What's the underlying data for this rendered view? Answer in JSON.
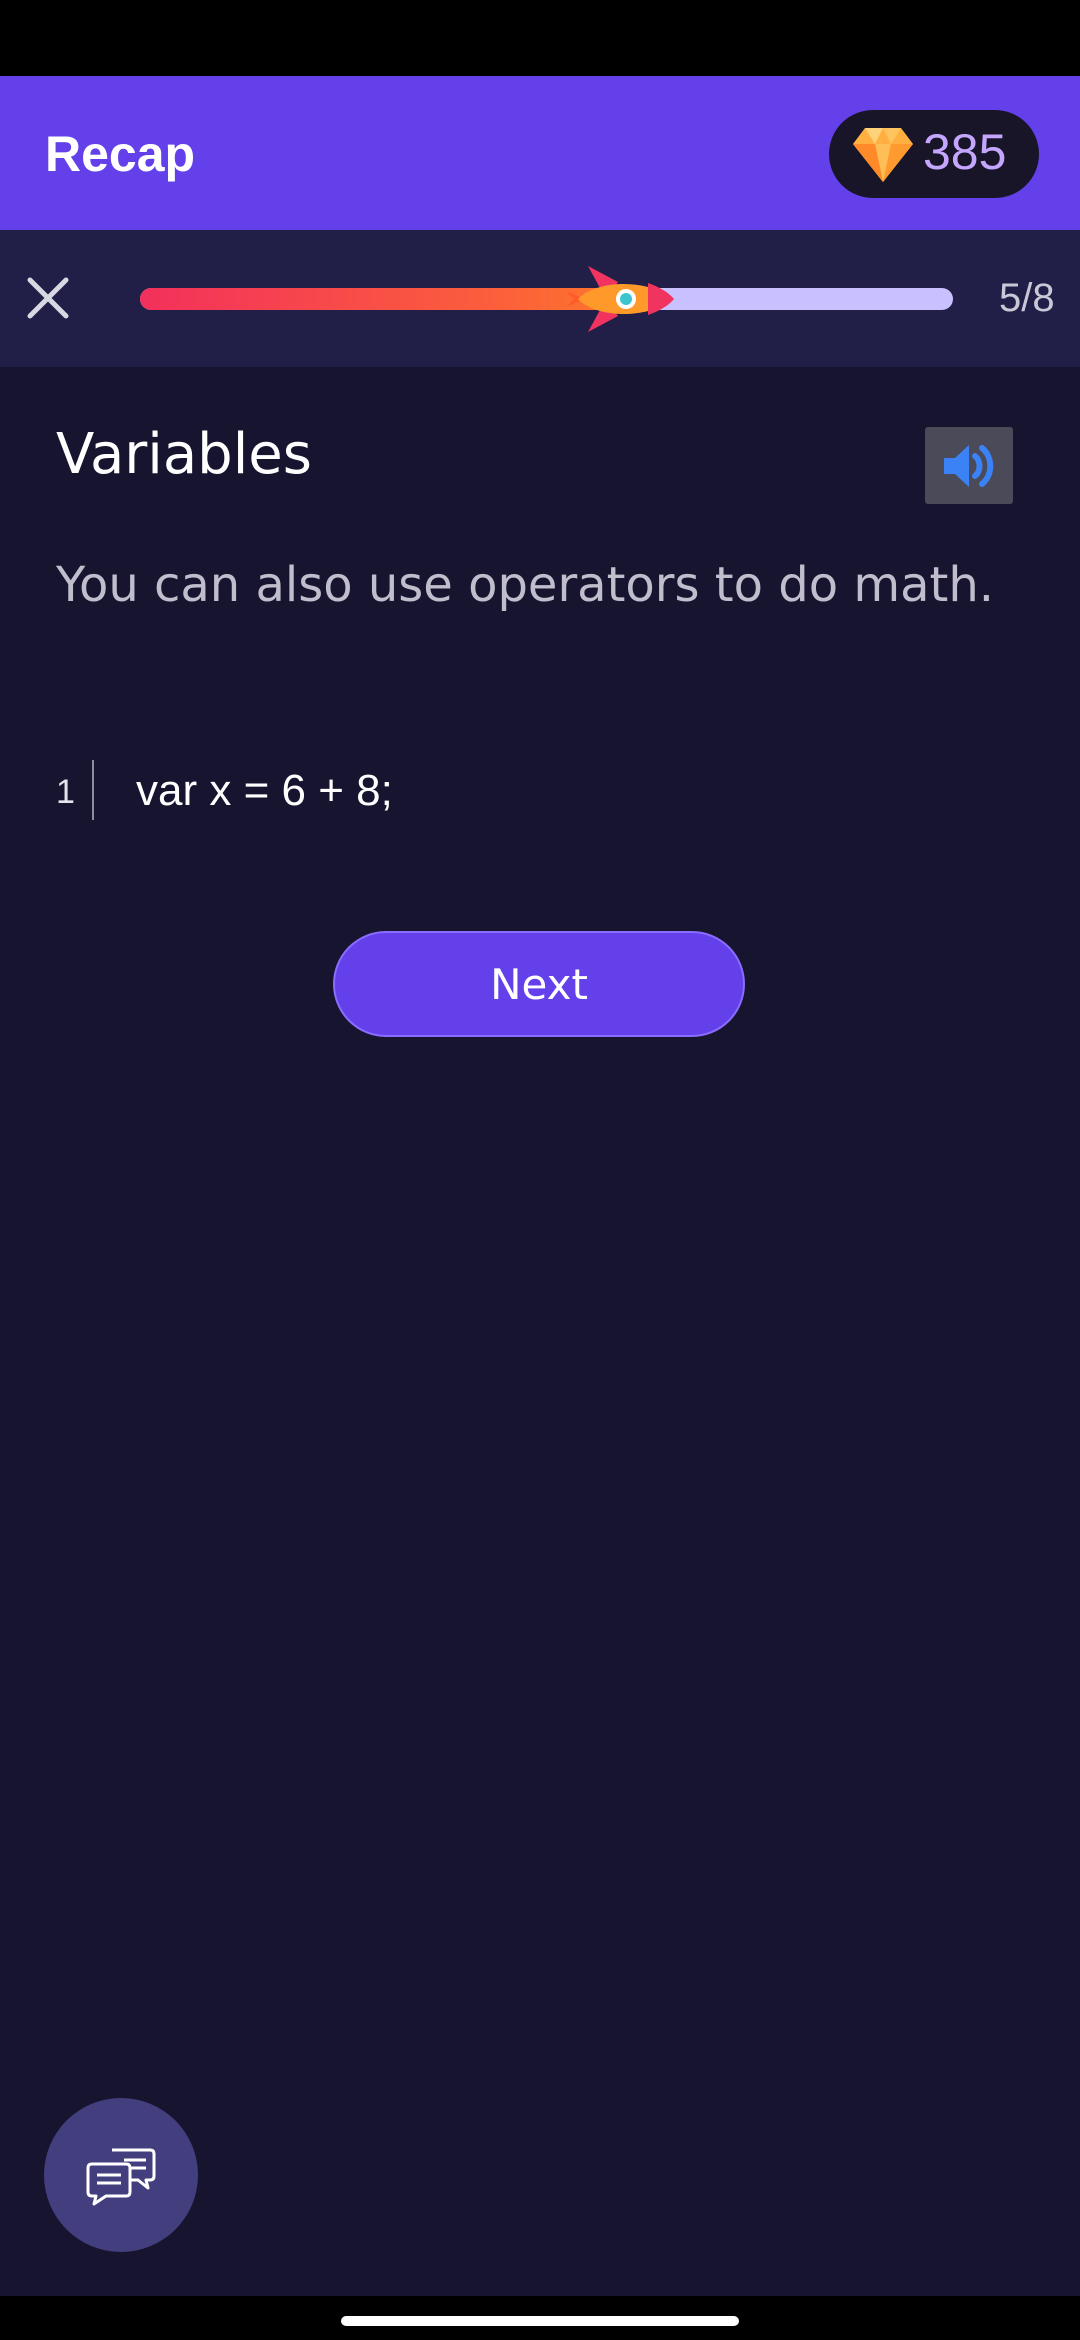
{
  "header": {
    "title": "Recap",
    "gems": "385",
    "gem_icon": "diamond-gem-icon"
  },
  "progress": {
    "current": 5,
    "total": 8,
    "label": "5/8",
    "fraction": 0.625,
    "close_icon": "close-icon",
    "marker_icon": "rocket-icon"
  },
  "lesson": {
    "title": "Variables",
    "body": "You can also use operators to do math.",
    "audio_icon": "speaker-icon",
    "code": [
      {
        "line": "1",
        "text": "var x = 6 + 8;"
      }
    ],
    "next_label": "Next"
  },
  "chat": {
    "icon": "chat-bubbles-icon"
  },
  "colors": {
    "accent": "#6340ea",
    "background": "#171430",
    "progress_start": "#f3305c",
    "progress_end": "#ff7a2a",
    "progress_track": "#c9c0ff",
    "gem_count": "#c5a6ff"
  }
}
